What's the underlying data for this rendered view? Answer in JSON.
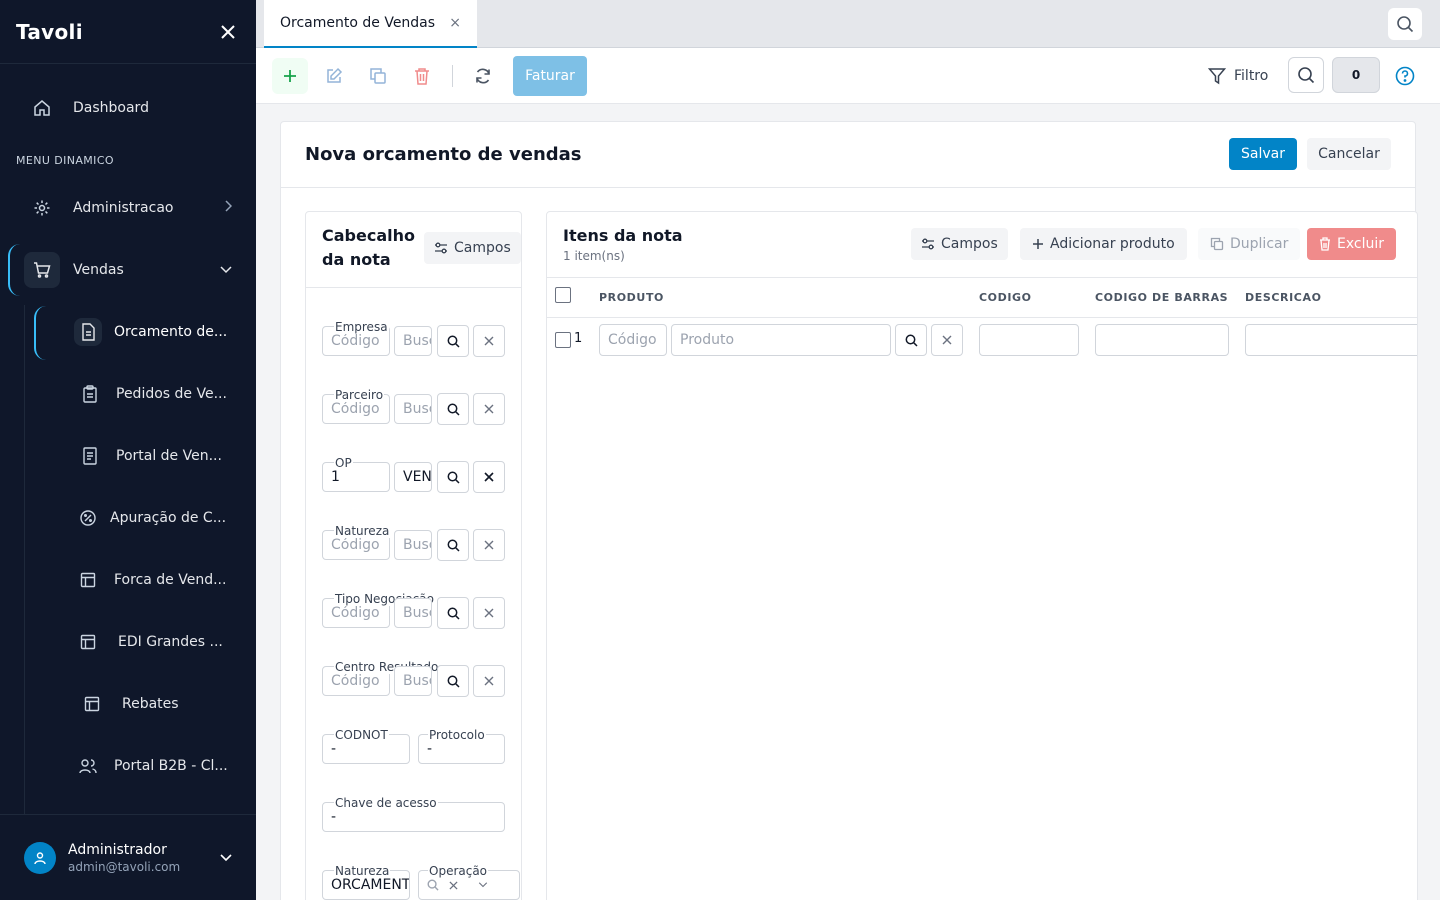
{
  "app": {
    "name": "Tavoli"
  },
  "sidebar": {
    "dashboard": "Dashboard",
    "section": "MENU DINAMICO",
    "administracao": "Administracao",
    "vendas": "Vendas",
    "sub": [
      {
        "label": "Orcamento de...",
        "icon": "document-icon"
      },
      {
        "label": "Pedidos de Ve...",
        "icon": "clipboard-icon"
      },
      {
        "label": "Portal de Ven...",
        "icon": "page-icon"
      },
      {
        "label": "Apuração de C...",
        "icon": "percent-badge-icon"
      },
      {
        "label": "Forca de Vend...",
        "icon": "layout-icon"
      },
      {
        "label": "EDI Grandes ...",
        "icon": "layout-icon"
      },
      {
        "label": "Rebates",
        "icon": "layout-icon"
      },
      {
        "label": "Portal B2B - Cl...",
        "icon": "users-icon"
      }
    ]
  },
  "user": {
    "name": "Administrador",
    "email": "admin@tavoli.com"
  },
  "tabs": [
    {
      "label": "Orcamento de Vendas",
      "close": "×"
    }
  ],
  "toolbar": {
    "faturar": "Faturar",
    "filtro": "Filtro",
    "count": "0"
  },
  "form": {
    "title": "Nova orcamento de vendas",
    "save": "Salvar",
    "cancel": "Cancelar"
  },
  "header_panel": {
    "title": "Cabecalho da nota",
    "campos": "Campos",
    "fields": [
      {
        "label": "Empresa",
        "code": "Código",
        "search": "Busca",
        "code_filled": false
      },
      {
        "label": "Parceiro",
        "code": "Código",
        "search": "Busca",
        "code_filled": false
      },
      {
        "label": "OP",
        "code": "1",
        "search": "VENDA",
        "code_filled": true
      },
      {
        "label": "Natureza",
        "code": "Código",
        "search": "Busca",
        "code_filled": false
      },
      {
        "label": "Tipo Negociação",
        "code": "Código",
        "search": "Busca",
        "code_filled": false
      },
      {
        "label": "Centro Resultado",
        "code": "Código",
        "search": "Busca",
        "code_filled": false
      }
    ],
    "codnot": {
      "label": "CODNOT",
      "value": "-"
    },
    "protocolo": {
      "label": "Protocolo",
      "value": "-"
    },
    "chave": {
      "label": "Chave de acesso",
      "value": "-"
    },
    "natureza2": {
      "label": "Natureza",
      "value": "ORCAMENTO"
    },
    "operacao": {
      "label": "Operação"
    }
  },
  "items_panel": {
    "title": "Itens da nota",
    "count": "1 item(ns)",
    "campos": "Campos",
    "add": "Adicionar produto",
    "duplicate": "Duplicar",
    "delete": "Excluir",
    "columns": [
      "PRODUTO",
      "CODIGO",
      "CODIGO DE BARRAS",
      "DESCRICAO"
    ],
    "rows": [
      {
        "num": "1",
        "code_placeholder": "Código",
        "product_placeholder": "Produto"
      }
    ]
  },
  "colors": {
    "accent": "#0284c7",
    "sidebar_bg": "#0f172a",
    "danger": "#f08b8b",
    "add": "#16a34a"
  }
}
